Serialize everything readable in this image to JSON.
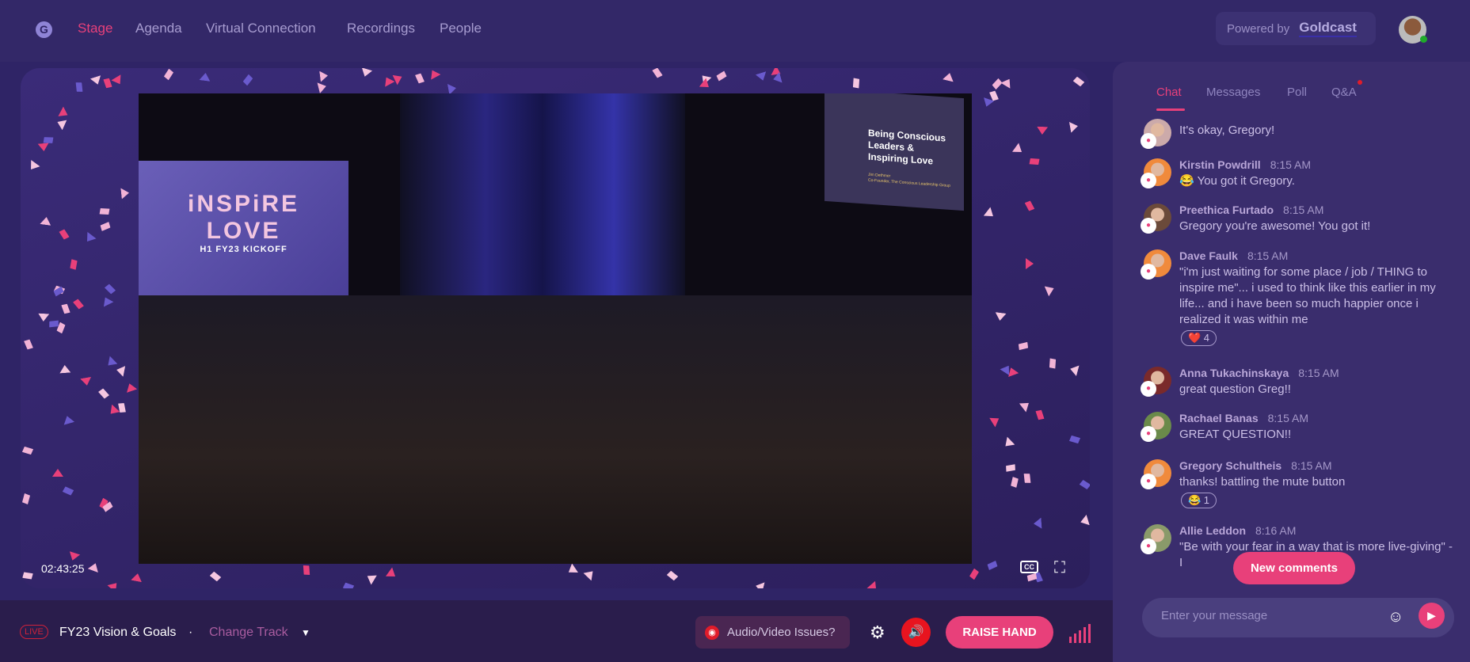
{
  "nav": {
    "items": [
      {
        "label": "Stage",
        "active": true
      },
      {
        "label": "Agenda"
      },
      {
        "label": "Virtual Connection"
      },
      {
        "label": "Recordings"
      },
      {
        "label": "People"
      }
    ]
  },
  "powered": {
    "prefix": "Powered by",
    "brand": "Goldcast"
  },
  "video": {
    "timestamp": "02:43:25",
    "cc": "CC",
    "backdrop": {
      "line1": "iNSPiRE",
      "line2": "LOVE",
      "line3": "H1 FY23 KICKOFF"
    },
    "slide": {
      "title": "Being Conscious Leaders & Inspiring Love",
      "speaker": "Jim Dethmer",
      "role": "Co-Founder, The Conscious Leadership Group"
    }
  },
  "bottom": {
    "live": "LIVE",
    "track": "FY23 Vision & Goals",
    "separator": "·",
    "change_track": "Change Track",
    "av_issues": "Audio/Video Issues?",
    "raise_hand": "RAISE HAND"
  },
  "chat": {
    "tabs": [
      "Chat",
      "Messages",
      "Poll",
      "Q&A"
    ],
    "messages": [
      {
        "name": "",
        "time": "",
        "text": "It's okay, Gregory!",
        "color": "#caa"
      },
      {
        "name": "Kirstin Powdrill",
        "time": "8:15 AM",
        "text": "😂  You got it Gregory.",
        "color": "#f08a3c"
      },
      {
        "name": "Preethica Furtado",
        "time": "8:15 AM",
        "text": "Gregory you're awesome! You got it!",
        "color": "#6b4a3a"
      },
      {
        "name": "Dave Faulk",
        "time": "8:15 AM",
        "text": "\"i'm just waiting for some place / job / THING to inspire me\"...  i used to think like this earlier in my life... and i have been so much happier once i realized it was within me",
        "color": "#f08a3c",
        "reaction": "❤️ 4"
      },
      {
        "name": "Anna Tukachinskaya",
        "time": "8:15 AM",
        "text": "great question Greg!!",
        "color": "#7a2a2a"
      },
      {
        "name": "Rachael Banas",
        "time": "8:15 AM",
        "text": "GREAT QUESTION!!",
        "color": "#6a8a4a"
      },
      {
        "name": "Gregory Schultheis",
        "time": "8:15 AM",
        "text": "thanks! battling the mute button",
        "color": "#f08a3c",
        "reaction": "😂 1"
      },
      {
        "name": "Allie Leddon",
        "time": "8:16 AM",
        "text": "\"Be with your fear in a way that is more live-giving\" - I",
        "color": "#8a9a6a"
      }
    ],
    "new_comments": "New comments",
    "placeholder": "Enter your message"
  },
  "colors": {
    "accent": "#e8407a",
    "bg": "#2f2466",
    "panel": "#3a2d6d"
  }
}
